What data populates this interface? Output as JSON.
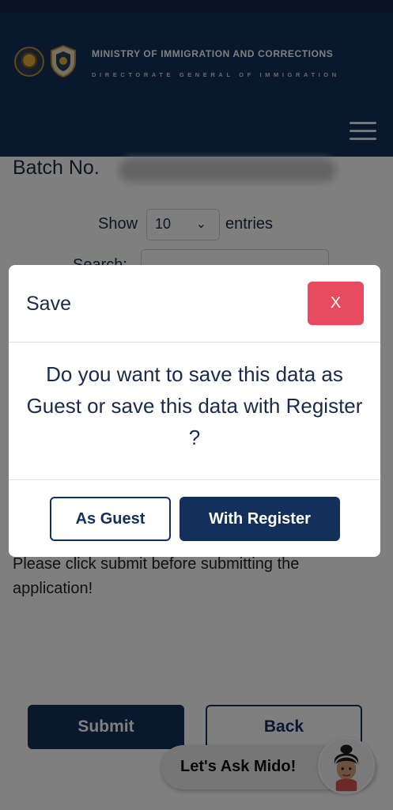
{
  "header": {
    "title": "MINISTRY OF IMMIGRATION AND CORRECTIONS",
    "subtitle": "DIRECTORATE GENERAL OF IMMIGRATION",
    "logos": [
      "emblem-icon",
      "shield-logo-icon"
    ],
    "menu_icon": "hamburger-menu-icon"
  },
  "main": {
    "batch_label": "Batch No.",
    "show_label": "Show",
    "entries_select_value": "10",
    "entries_label": "entries",
    "search_label": "Search:",
    "search_value": "",
    "notice": "Please click submit before submitting the application!",
    "submit_label": "Submit",
    "back_label": "Back"
  },
  "chat": {
    "label": "Let's Ask Mido!",
    "avatar_icon": "mido-avatar-icon"
  },
  "modal": {
    "title": "Save",
    "close_label": "X",
    "message": "Do you want to save this data as Guest or save this data with Register ?",
    "guest_label": "As Guest",
    "register_label": "With Register"
  },
  "colors": {
    "header_bg": "#13305a",
    "top_strip": "#0f2747",
    "primary": "#13305a",
    "close_button": "#e84a5f",
    "overlay": "rgba(0,0,0,0.5)"
  }
}
